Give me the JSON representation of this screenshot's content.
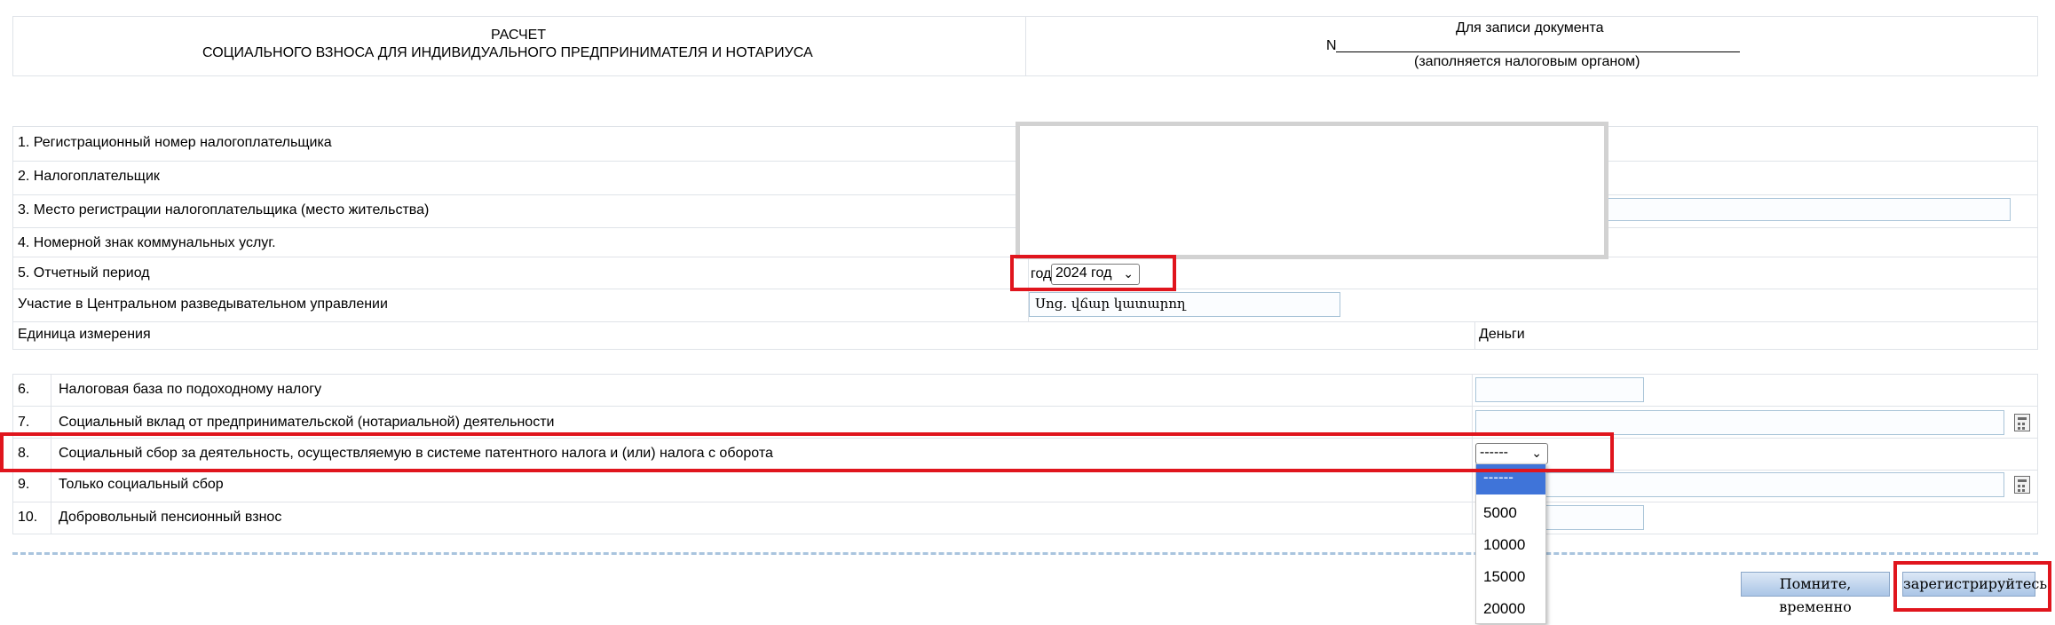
{
  "header": {
    "title_line1": "РАСЧЕТ",
    "title_line2": "СОЦИАЛЬНОГО ВЗНОСА ДЛЯ ИНДИВИДУАЛЬНОГО ПРЕДПРИНИМАТЕЛЯ И НОТАРИУСА",
    "doc_record_label": "Для записи документа",
    "doc_number_prefix": "N",
    "doc_note": "(заполняется налоговым органом)"
  },
  "fields": {
    "reg_number": "1. Регистрационный номер налогоплательщика",
    "taxpayer": "2. Налогоплательщик",
    "registration_place": "3. Место регистрации налогоплательщика (место жительства)",
    "utility_code": "4. Номерной знак коммунальных услуг.",
    "period": "5. Отчетный период",
    "period_prefix": "год",
    "period_value": "2024 год",
    "cia_participation": "Участие в Центральном разведывательном управлении",
    "cia_value": "Սոց. վճար կատարող",
    "unit_label": "Единица измерения",
    "unit_value": "Деньги"
  },
  "rows": [
    {
      "num": "6.",
      "label": "Налоговая база по подоходному налогу"
    },
    {
      "num": "7.",
      "label": "Социальный вклад от предпринимательской (нотариальной) деятельности"
    },
    {
      "num": "8.",
      "label": "Социальный сбор за деятельность, осуществляемую в системе патентного налога и (или) налога с оборота"
    },
    {
      "num": "9.",
      "label": "Только социальный сбор"
    },
    {
      "num": "10.",
      "label": "Добровольный пенсионный взнос"
    }
  ],
  "social_fee_select": {
    "selected": "------",
    "options": [
      "------",
      "5000",
      "10000",
      "15000",
      "20000"
    ]
  },
  "buttons": {
    "remember": "Помните, временно",
    "register": "зарегистрируйтесь"
  },
  "colors": {
    "highlight": "#e0151d",
    "border": "#dfe3e8",
    "selected_option": "#3f74d9"
  }
}
